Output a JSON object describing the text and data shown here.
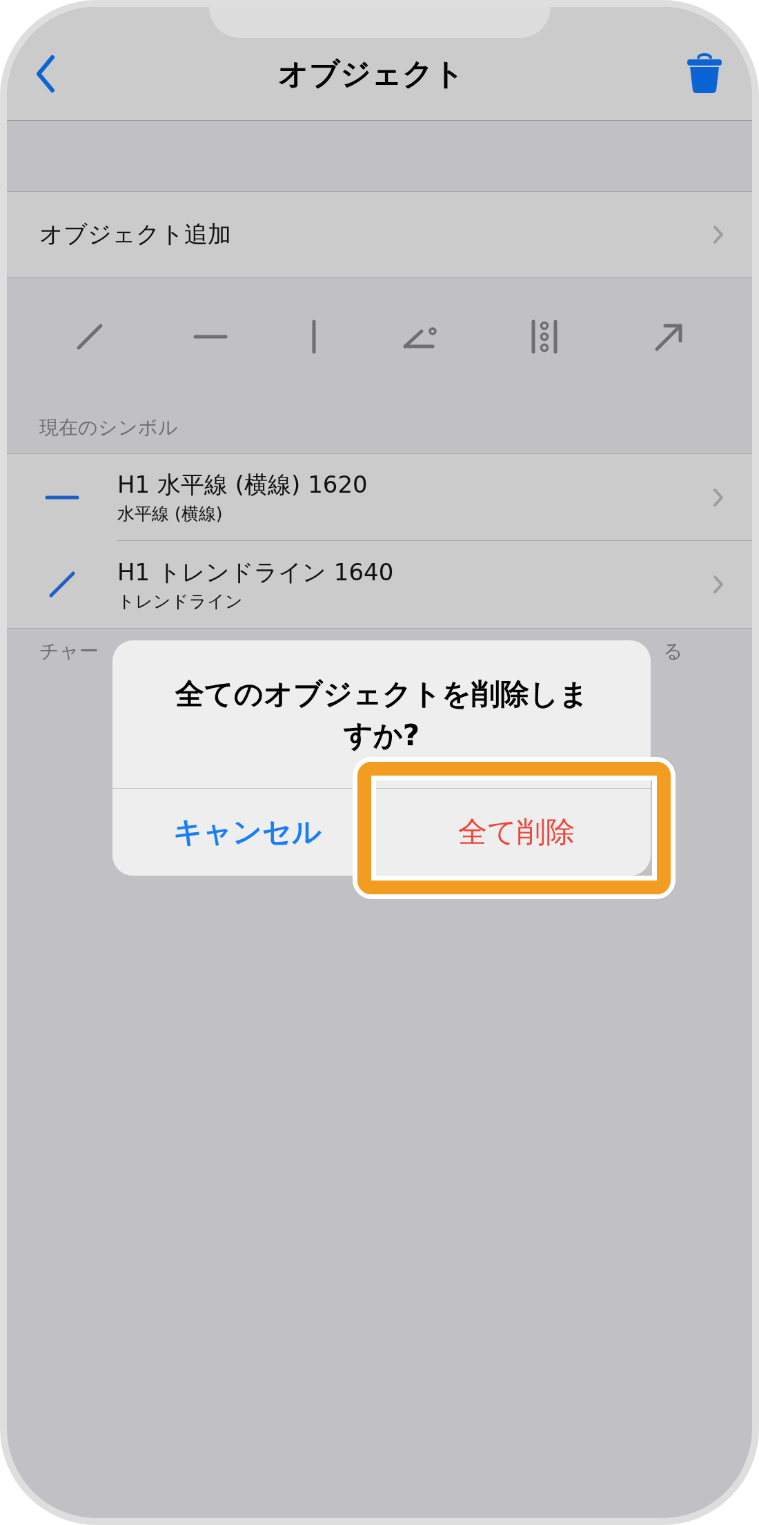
{
  "nav": {
    "title": "オブジェクト"
  },
  "add_row": {
    "label": "オブジェクト追加"
  },
  "tools": [
    {
      "kind": "diagonal"
    },
    {
      "kind": "horizontal"
    },
    {
      "kind": "vertical"
    },
    {
      "kind": "angle"
    },
    {
      "kind": "fibonacci"
    },
    {
      "kind": "arrow"
    }
  ],
  "section_header": "現在のシンボル",
  "symbols": [
    {
      "kind": "horizontal",
      "title": "H1 水平線 (横線) 1620",
      "subtitle": "水平線 (横線)"
    },
    {
      "kind": "diagonal",
      "title": "H1 トレンドライン 1640",
      "subtitle": "トレンドライン"
    }
  ],
  "footer_note": {
    "start": "チャー",
    "end": "る"
  },
  "dialog": {
    "message": "全てのオブジェクトを削除しますか?",
    "buttons": [
      {
        "kind": "cancel",
        "label": "キャンセル",
        "highlighted": false
      },
      {
        "kind": "destructive",
        "label": "全て削除",
        "highlighted": true
      }
    ]
  }
}
